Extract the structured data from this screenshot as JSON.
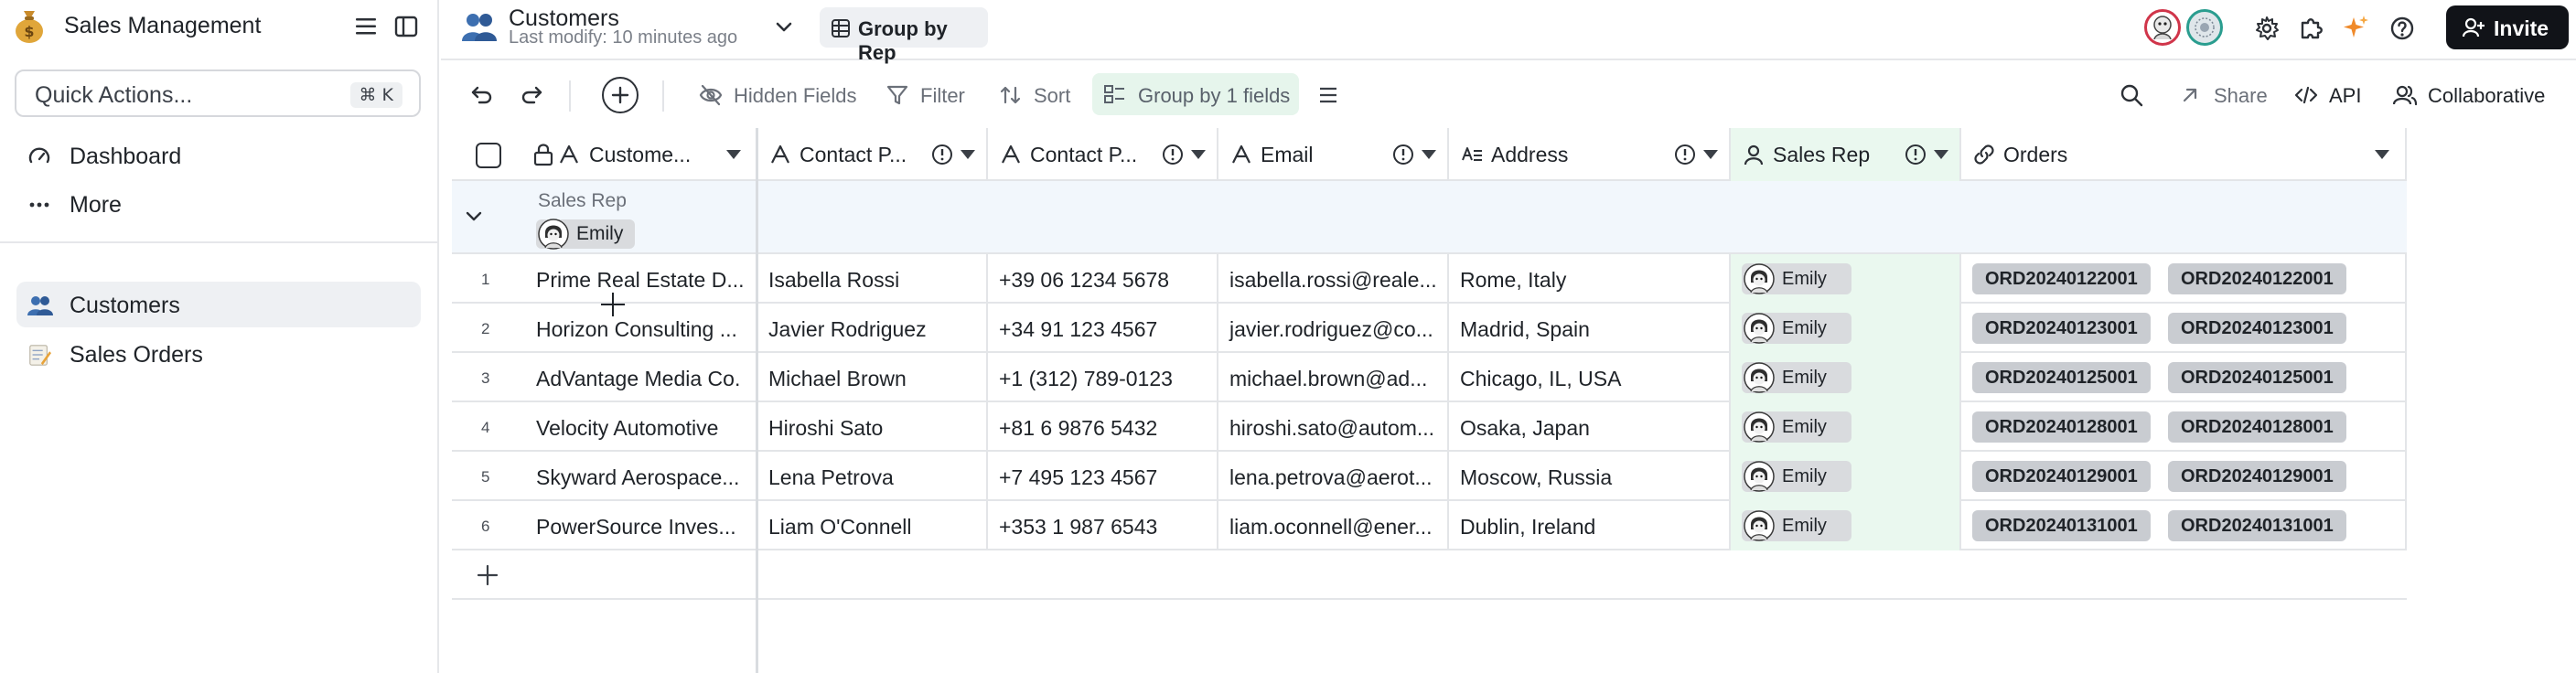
{
  "app": {
    "title": "Sales Management",
    "quick_actions": {
      "label": "Quick Actions...",
      "shortcut": "⌘ K"
    },
    "nav_top": [
      {
        "label": "Dashboard",
        "icon": "gauge-icon"
      },
      {
        "label": "More",
        "icon": "more-dots-icon"
      }
    ],
    "tables": [
      {
        "label": "Customers",
        "icon": "people-emoji-icon",
        "active": true
      },
      {
        "label": "Sales Orders",
        "icon": "memo-emoji-icon",
        "active": false
      }
    ]
  },
  "header": {
    "table_name": "Customers",
    "last_modified": "Last modify: 10 minutes ago",
    "view_name": "Group by Rep",
    "invite_label": "Invite"
  },
  "toolbar": {
    "hidden_fields": "Hidden Fields",
    "filter": "Filter",
    "sort": "Sort",
    "group": "Group by 1 fields",
    "share": "Share",
    "api": "API",
    "collaborative": "Collaborative"
  },
  "columns": [
    {
      "label": "Custome...",
      "icon": "text-icon"
    },
    {
      "label": "Contact P...",
      "icon": "text-icon"
    },
    {
      "label": "Contact P...",
      "icon": "text-icon"
    },
    {
      "label": "Email",
      "icon": "text-icon"
    },
    {
      "label": "Address",
      "icon": "long-text-icon"
    },
    {
      "label": "Sales Rep",
      "icon": "user-icon"
    },
    {
      "label": "Orders",
      "icon": "link-icon"
    }
  ],
  "group": {
    "field": "Sales Rep",
    "value": "Emily"
  },
  "rows": [
    {
      "n": "1",
      "customer": "Prime Real Estate D...",
      "contact_name": "Isabella Rossi",
      "phone": "+39 06 1234 5678",
      "email": "isabella.rossi@reale...",
      "address": "Rome, Italy",
      "rep": "Emily",
      "orders": [
        "ORD20240122001",
        "ORD20240122001"
      ]
    },
    {
      "n": "2",
      "customer": "Horizon Consulting ...",
      "contact_name": "Javier Rodriguez",
      "phone": "+34 91 123 4567",
      "email": "javier.rodriguez@co...",
      "address": "Madrid, Spain",
      "rep": "Emily",
      "orders": [
        "ORD20240123001",
        "ORD20240123001"
      ]
    },
    {
      "n": "3",
      "customer": "AdVantage Media Co.",
      "contact_name": "Michael Brown",
      "phone": "+1 (312) 789-0123",
      "email": "michael.brown@ad...",
      "address": "Chicago, IL, USA",
      "rep": "Emily",
      "orders": [
        "ORD20240125001",
        "ORD20240125001"
      ]
    },
    {
      "n": "4",
      "customer": "Velocity Automotive",
      "contact_name": "Hiroshi Sato",
      "phone": "+81 6 9876 5432",
      "email": "hiroshi.sato@autom...",
      "address": "Osaka, Japan",
      "rep": "Emily",
      "orders": [
        "ORD20240128001",
        "ORD20240128001"
      ]
    },
    {
      "n": "5",
      "customer": "Skyward Aerospace...",
      "contact_name": "Lena Petrova",
      "phone": "+7 495 123 4567",
      "email": "lena.petrova@aerot...",
      "address": "Moscow, Russia",
      "rep": "Emily",
      "orders": [
        "ORD20240129001",
        "ORD20240129001"
      ]
    },
    {
      "n": "6",
      "customer": "PowerSource Inves...",
      "contact_name": "Liam O'Connell",
      "phone": "+353 1 987 6543",
      "email": "liam.oconnell@ener...",
      "address": "Dublin, Ireland",
      "rep": "Emily",
      "orders": [
        "ORD20240131001",
        "ORD20240131001"
      ]
    }
  ],
  "colors": {
    "accent_group": "#e6f5ec",
    "rep_column_bg": "#eaf8ef",
    "group_row_bg": "#f2f7fc",
    "invite_bg": "#111318",
    "chip_bg": "#d9dbde",
    "order_chip_bg": "#c9ccd1"
  }
}
